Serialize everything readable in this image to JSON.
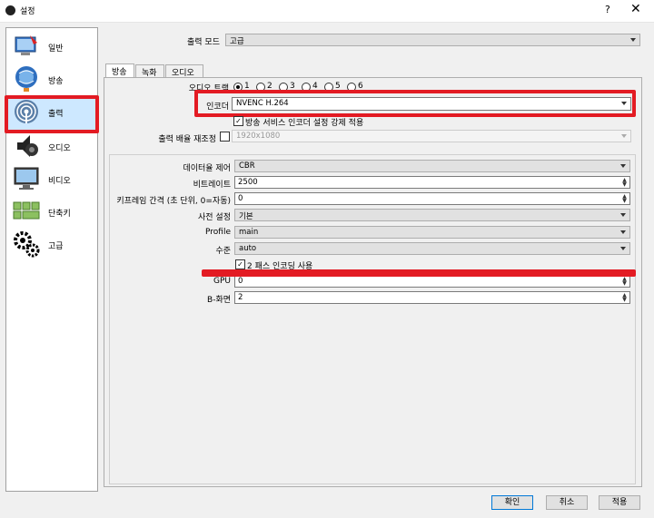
{
  "window": {
    "title": "설정",
    "help_label": "?",
    "close_label": "✕"
  },
  "sidebar": {
    "items": [
      {
        "label": "일반",
        "icon": "general-icon"
      },
      {
        "label": "방송",
        "icon": "stream-icon"
      },
      {
        "label": "출력",
        "icon": "output-icon"
      },
      {
        "label": "오디오",
        "icon": "audio-icon"
      },
      {
        "label": "비디오",
        "icon": "video-icon"
      },
      {
        "label": "단축키",
        "icon": "hotkeys-icon"
      },
      {
        "label": "고급",
        "icon": "advanced-icon"
      }
    ],
    "selected": "출력"
  },
  "output_mode": {
    "label": "출력 모드",
    "value": "고급"
  },
  "tabs": [
    {
      "label": "방송"
    },
    {
      "label": "녹화"
    },
    {
      "label": "오디오"
    }
  ],
  "stream": {
    "audio_track_label": "오디오 트랙",
    "tracks": [
      "1",
      "2",
      "3",
      "4",
      "5",
      "6"
    ],
    "encoder_label": "인코더",
    "encoder_value": "NVENC H.264",
    "enforce_label": "방송 서비스 인코더 설정 강제 적용",
    "rescale_label": "출력 배율 재조정",
    "rescale_value": "1920x1080"
  },
  "encoder_settings": {
    "rate_control": {
      "label": "데이터율 제어",
      "value": "CBR"
    },
    "bitrate": {
      "label": "비트레이트",
      "value": "2500"
    },
    "keyframe": {
      "label": "키프레임 간격 (초 단위, 0=자동)",
      "value": "0"
    },
    "preset": {
      "label": "사전 설정",
      "value": "기본"
    },
    "profile": {
      "label": "Profile",
      "value": "main"
    },
    "level": {
      "label": "수준",
      "value": "auto"
    },
    "twopass_label": "2 패스 인코딩 사용",
    "gpu": {
      "label": "GPU",
      "value": "0"
    },
    "bframes": {
      "label": "B-화면",
      "value": "2"
    }
  },
  "buttons": {
    "ok": "확인",
    "cancel": "취소",
    "apply": "적용"
  },
  "colors": {
    "highlight": "#e31b23",
    "selection": "#cde8ff"
  }
}
